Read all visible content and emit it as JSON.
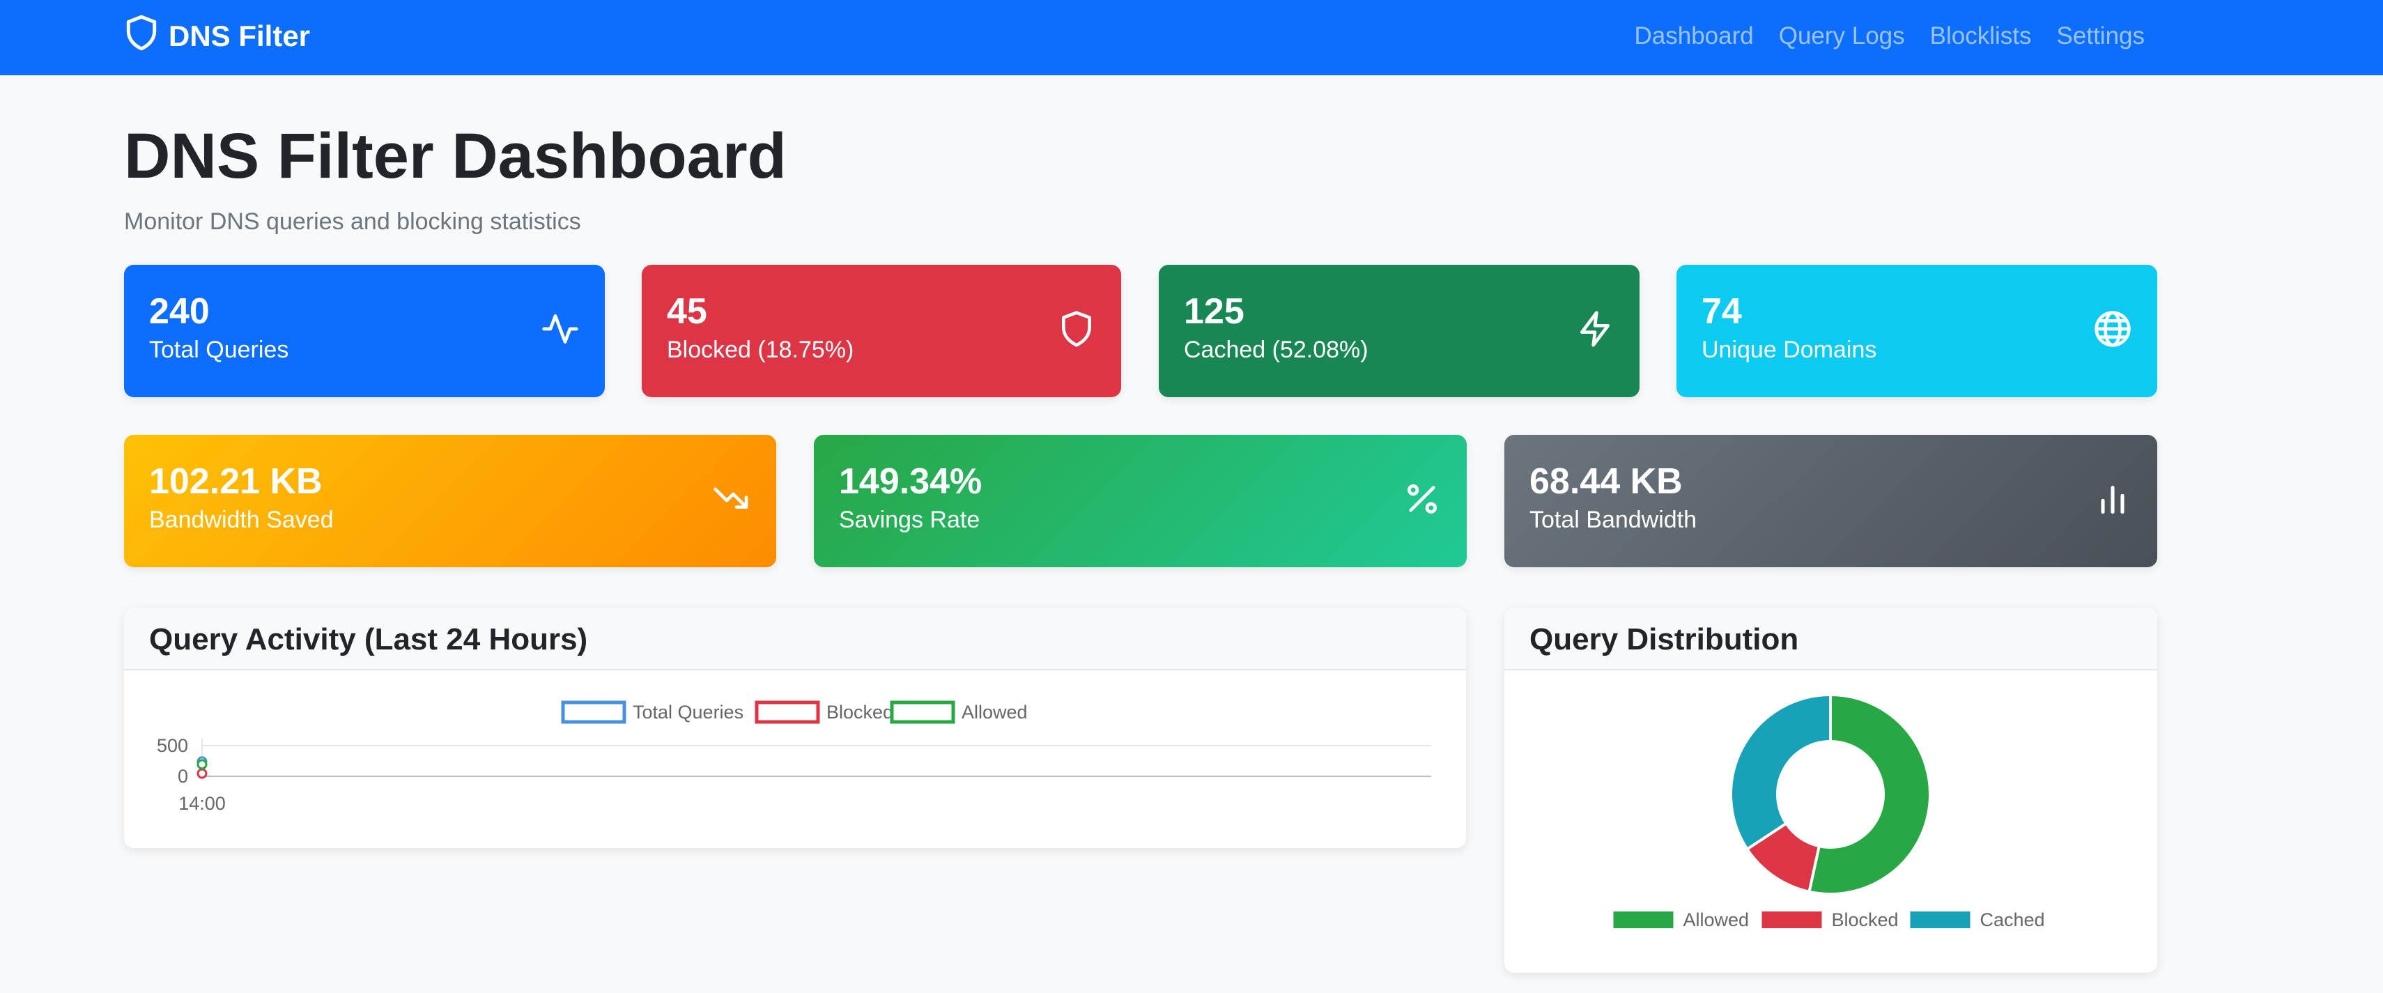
{
  "navbar": {
    "brand": "DNS Filter",
    "links": [
      "Dashboard",
      "Query Logs",
      "Blocklists",
      "Settings"
    ]
  },
  "header": {
    "title": "DNS Filter Dashboard",
    "subtitle": "Monitor DNS queries and blocking statistics"
  },
  "stats_row1": [
    {
      "value": "240",
      "label": "Total Queries",
      "icon": "activity-icon",
      "color": "#0d6efd"
    },
    {
      "value": "45",
      "label": "Blocked (18.75%)",
      "icon": "shield-icon",
      "color": "#dc3545"
    },
    {
      "value": "125",
      "label": "Cached (52.08%)",
      "icon": "lightning-icon",
      "color": "#198754"
    },
    {
      "value": "74",
      "label": "Unique Domains",
      "icon": "globe-icon",
      "color": "#0dcaf0"
    }
  ],
  "stats_row2": [
    {
      "value": "102.21 KB",
      "label": "Bandwidth Saved",
      "icon": "trending-down-icon",
      "color_start": "#ffc107",
      "color_end": "#fd8c00"
    },
    {
      "value": "149.34%",
      "label": "Savings Rate",
      "icon": "percent-icon",
      "color_start": "#28a745",
      "color_end": "#20c997"
    },
    {
      "value": "68.44 KB",
      "label": "Total Bandwidth",
      "icon": "bar-chart-icon",
      "color_start": "#6c757d",
      "color_end": "#495057"
    }
  ],
  "activity_panel": {
    "title": "Query Activity (Last 24 Hours)"
  },
  "distribution_panel": {
    "title": "Query Distribution"
  },
  "chart_data": [
    {
      "type": "line",
      "x": [
        "14:00"
      ],
      "series": [
        {
          "name": "Total Queries",
          "values": [
            240
          ],
          "color": "#4a90e2"
        },
        {
          "name": "Blocked",
          "values": [
            45
          ],
          "color": "#dc3545"
        },
        {
          "name": "Allowed",
          "values": [
            195
          ],
          "color": "#28a745"
        }
      ],
      "yticks": [
        "500",
        "0"
      ],
      "ylim": [
        0,
        500
      ],
      "grid": true,
      "legend": "top-center"
    },
    {
      "type": "pie",
      "donut": true,
      "categories": [
        "Allowed",
        "Blocked",
        "Cached"
      ],
      "values": [
        195,
        45,
        125
      ],
      "colors": [
        "#28a745",
        "#dc3545",
        "#17a2b8"
      ],
      "legend": "bottom"
    }
  ]
}
